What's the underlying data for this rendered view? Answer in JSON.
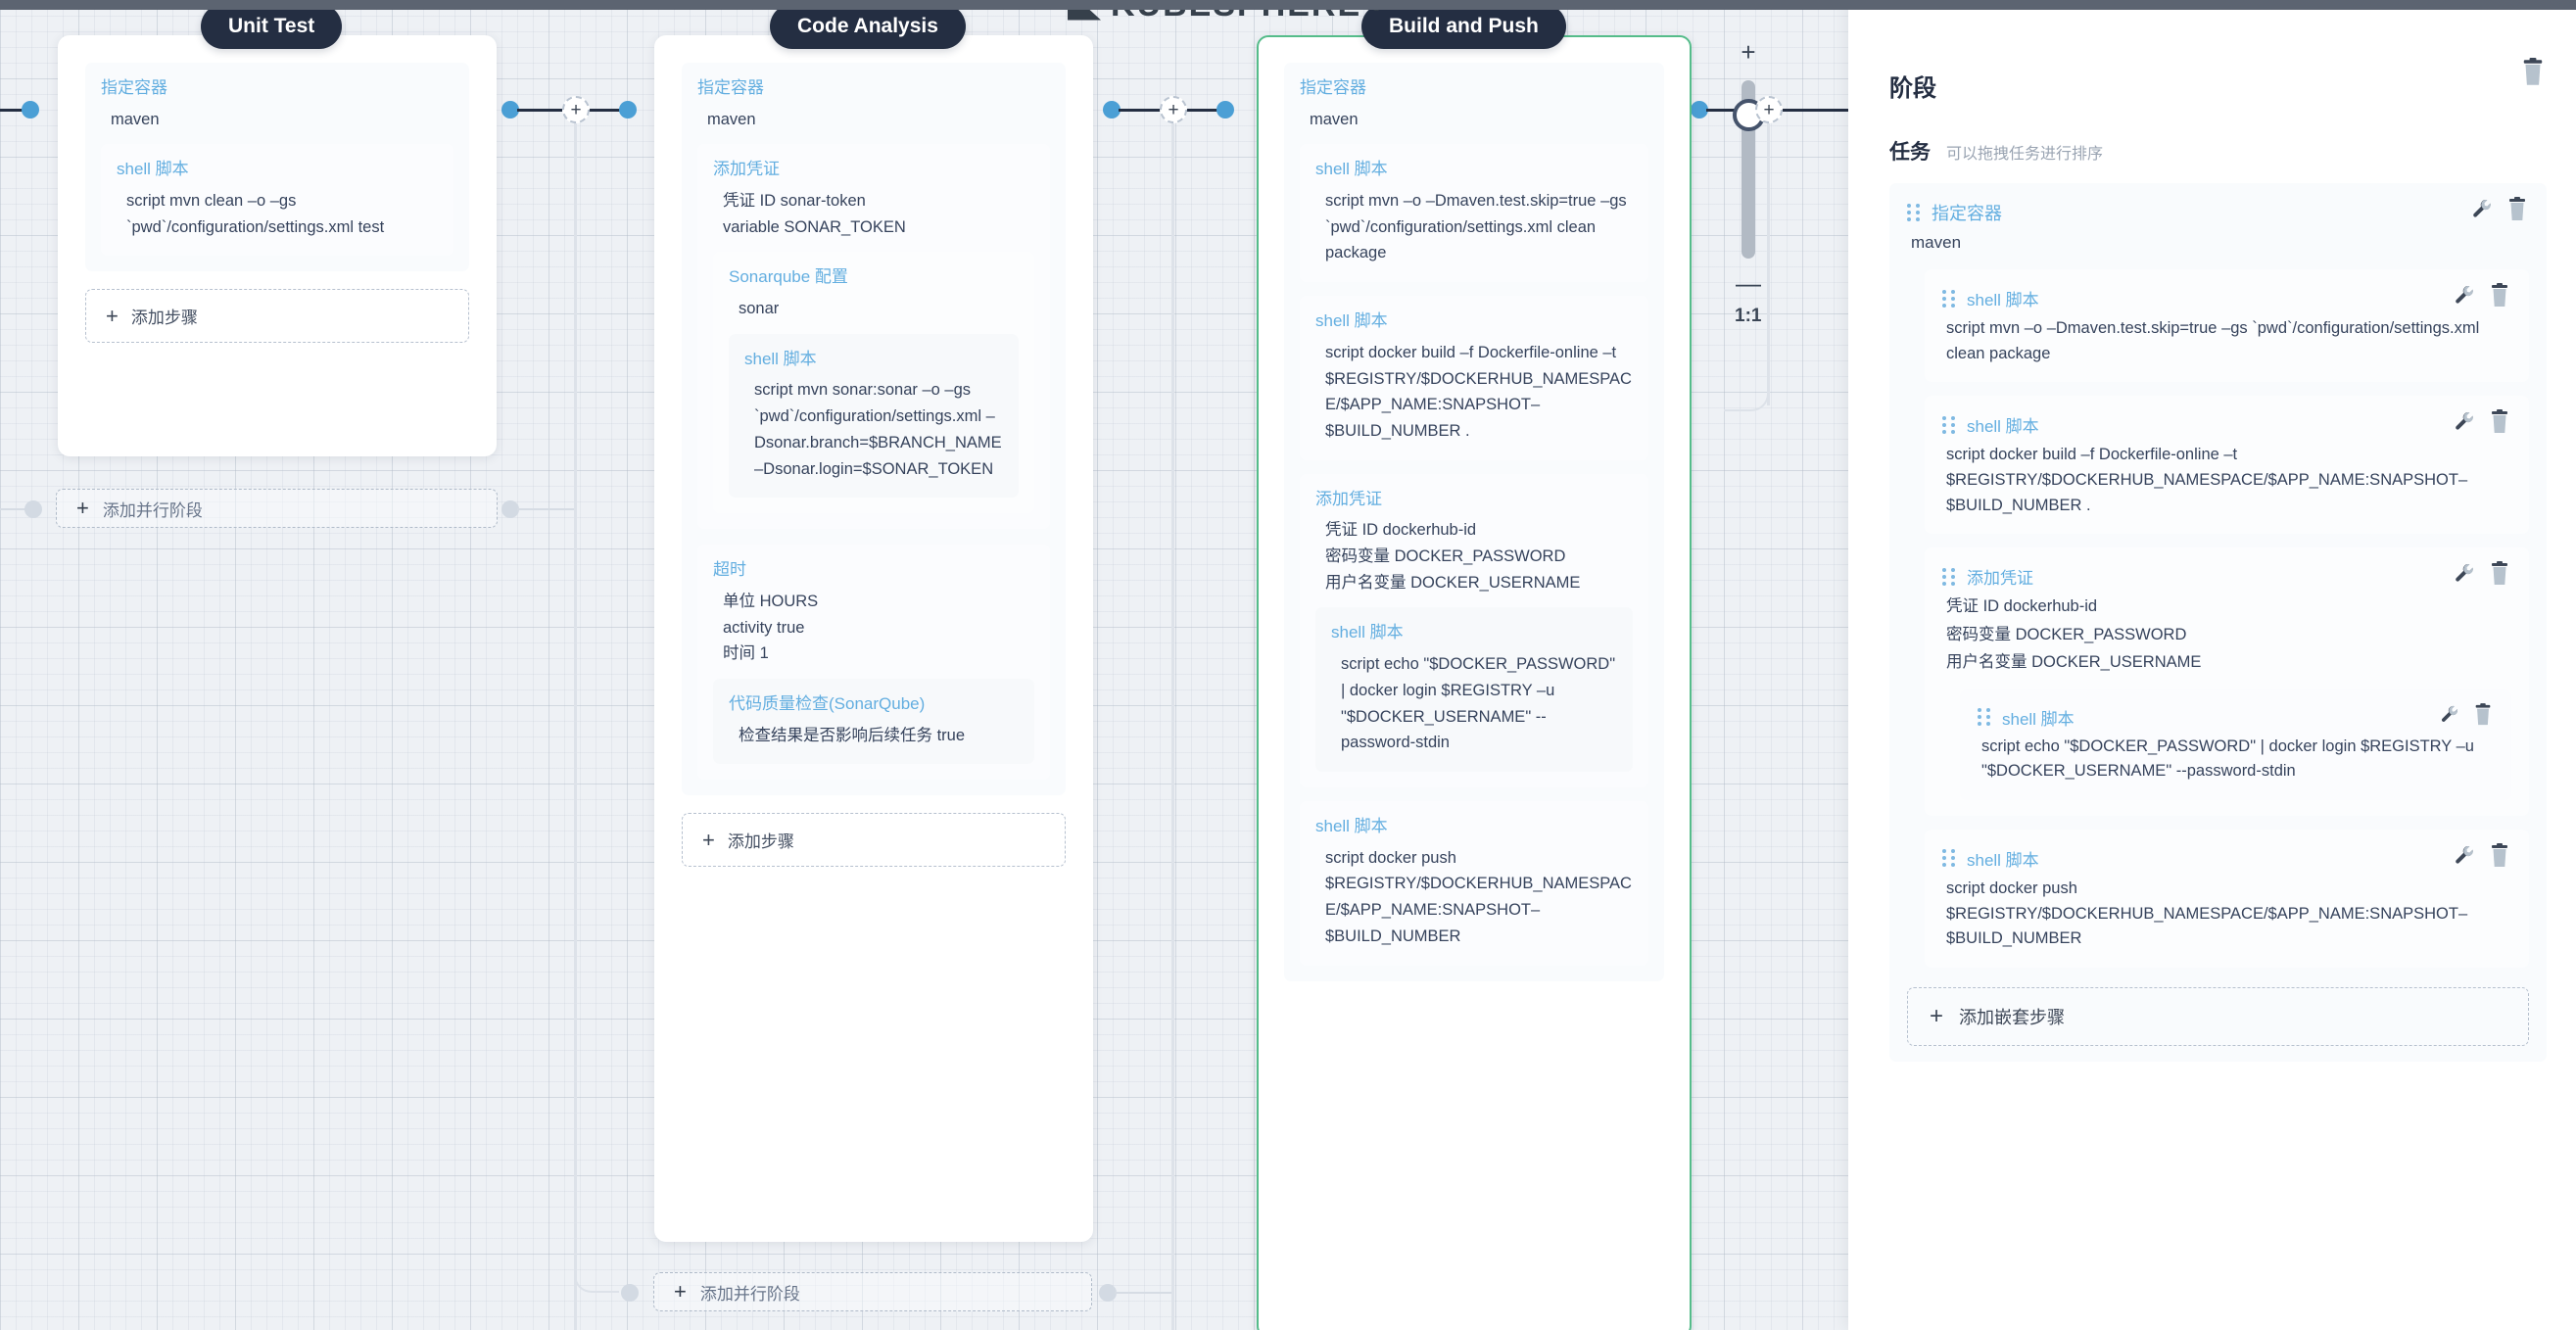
{
  "app": {
    "watermark": "KUBESPHERE",
    "watermark_reg": "®"
  },
  "zoom_control": {
    "plus_label": "+",
    "minus_label": "—",
    "ratio_label": "1:1"
  },
  "canvas": {
    "add_parallel_stage_label": "+ 添加并行阶段",
    "add_parallel_plus": "+",
    "add_parallel_text": "添加并行阶段",
    "add_step_plus": "+",
    "add_step_text": "添加步骤",
    "connector_plus": "+"
  },
  "stages": [
    {
      "name": "Unit Test",
      "selected": false,
      "blocks": [
        {
          "title": "指定容器",
          "rows": [
            "maven"
          ],
          "children": [
            {
              "title": "shell 脚本",
              "rows": [
                "script   mvn clean –o –gs `pwd`/configuration/settings.xml test"
              ],
              "children": []
            }
          ]
        }
      ],
      "add_step": "添加步骤"
    },
    {
      "name": "Code Analysis",
      "selected": false,
      "blocks": [
        {
          "title": "指定容器",
          "rows": [
            "maven"
          ],
          "children": [
            {
              "title": "添加凭证",
              "rows": [
                "凭证 ID   sonar-token",
                "variable   SONAR_TOKEN"
              ],
              "children": [
                {
                  "title": "Sonarqube 配置",
                  "rows": [
                    "sonar"
                  ],
                  "children": [
                    {
                      "title": "shell 脚本",
                      "rows": [
                        "script   mvn sonar:sonar –o –gs `pwd`/configuration/settings.xml –Dsonar.branch=$BRANCH_NAME –Dsonar.login=$SONAR_TOKEN"
                      ],
                      "children": []
                    }
                  ]
                }
              ]
            },
            {
              "title": "超时",
              "rows": [
                "单位   HOURS",
                "activity   true",
                "时间   1"
              ],
              "children": [
                {
                  "title": "代码质量检查(SonarQube)",
                  "rows": [
                    "检查结果是否影响后续任务   true"
                  ],
                  "children": []
                }
              ]
            }
          ]
        }
      ],
      "add_step": "添加步骤"
    },
    {
      "name": "Build and Push",
      "selected": true,
      "blocks": [
        {
          "title": "指定容器",
          "rows": [
            "maven"
          ],
          "children": [
            {
              "title": "shell 脚本",
              "rows": [
                "script   mvn –o –Dmaven.test.skip=true –gs `pwd`/configuration/settings.xml clean package"
              ],
              "children": []
            },
            {
              "title": "shell 脚本",
              "rows": [
                "script   docker build –f Dockerfile-online –t $REGISTRY/$DOCKERHUB_NAMESPACE/$APP_NAME:SNAPSHOT–$BUILD_NUMBER ."
              ],
              "children": []
            },
            {
              "title": "添加凭证",
              "rows": [
                "凭证 ID   dockerhub-id",
                "密码变量   DOCKER_PASSWORD",
                "用户名变量   DOCKER_USERNAME"
              ],
              "children": [
                {
                  "title": "shell 脚本",
                  "rows": [
                    "script   echo \"$DOCKER_PASSWORD\" | docker login $REGISTRY –u \"$DOCKER_USERNAME\" --password-stdin"
                  ],
                  "children": []
                }
              ]
            },
            {
              "title": "shell 脚本",
              "rows": [
                "script   docker push $REGISTRY/$DOCKERHUB_NAMESPACE/$APP_NAME:SNAPSHOT–$BUILD_NUMBER"
              ],
              "children": []
            }
          ]
        }
      ],
      "add_step": "添加步骤"
    }
  ],
  "panel": {
    "title": "阶段",
    "delete_icon": "trash-icon",
    "tasks_title": "任务",
    "tasks_hint": "可以拖拽任务进行排序",
    "add_nested_plus": "+",
    "add_nested_label": "添加嵌套步骤",
    "tasks": [
      {
        "title": "指定容器",
        "rows": [
          "maven"
        ],
        "nested": [
          {
            "title": "shell 脚本",
            "rows": [
              "script   mvn –o –Dmaven.test.skip=true –gs `pwd`/configuration/settings.xml clean package"
            ],
            "nested": []
          },
          {
            "title": "shell 脚本",
            "rows": [
              "script   docker build –f Dockerfile-online –t $REGISTRY/$DOCKERHUB_NAMESPACE/$APP_NAME:SNAPSHOT–$BUILD_NUMBER ."
            ],
            "nested": []
          },
          {
            "title": "添加凭证",
            "rows": [
              "凭证 ID   dockerhub-id",
              "密码变量   DOCKER_PASSWORD",
              "用户名变量   DOCKER_USERNAME"
            ],
            "nested": [
              {
                "title": "shell 脚本",
                "rows": [
                  "script   echo \"$DOCKER_PASSWORD\" | docker login $REGISTRY –u \"$DOCKER_USERNAME\" --password-stdin"
                ],
                "nested": []
              }
            ]
          },
          {
            "title": "shell 脚本",
            "rows": [
              "script   docker push $REGISTRY/$DOCKERHUB_NAMESPACE/$APP_NAME:SNAPSHOT–$BUILD_NUMBER"
            ],
            "nested": []
          }
        ]
      }
    ]
  },
  "colors": {
    "accent_blue": "#4b9fd5",
    "title_blue": "#63aee0",
    "dark": "#242e42",
    "selected_green": "#55bc8a",
    "canvas_bg": "#eef1f5"
  }
}
